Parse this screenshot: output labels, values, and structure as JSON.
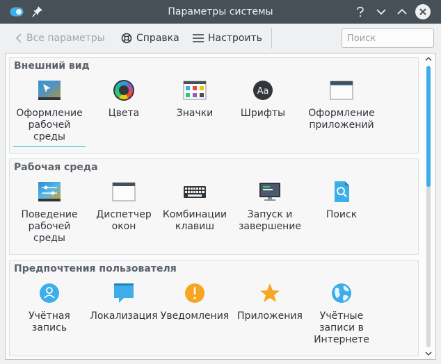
{
  "window": {
    "title": "Параметры системы"
  },
  "toolbar": {
    "back_label": "Все параметры",
    "help_label": "Справка",
    "configure_label": "Настроить",
    "search_placeholder": "Поиск"
  },
  "colors": {
    "accent": "#3daee9",
    "titlebar": "#475057"
  },
  "sections": [
    {
      "title": "Внешний вид",
      "items": [
        {
          "label": "Оформление рабочей среды",
          "icon": "workspace-theme-icon"
        },
        {
          "label": "Цвета",
          "icon": "colors-icon"
        },
        {
          "label": "Значки",
          "icon": "icons-icon"
        },
        {
          "label": "Шрифты",
          "icon": "fonts-icon"
        },
        {
          "label": "Оформление приложений",
          "icon": "app-style-icon"
        }
      ]
    },
    {
      "title": "Рабочая среда",
      "items": [
        {
          "label": "Поведение рабочей среды",
          "icon": "workspace-behavior-icon"
        },
        {
          "label": "Диспетчер окон",
          "icon": "window-manager-icon"
        },
        {
          "label": "Комбинации клавиш",
          "icon": "keyboard-icon"
        },
        {
          "label": "Запуск и завершение",
          "icon": "startup-shutdown-icon"
        },
        {
          "label": "Поиск",
          "icon": "search-icon"
        }
      ]
    },
    {
      "title": "Предпочтения пользователя",
      "items": [
        {
          "label": "Учётная запись",
          "icon": "user-account-icon"
        },
        {
          "label": "Локализация",
          "icon": "locale-icon"
        },
        {
          "label": "Уведомления",
          "icon": "notifications-icon"
        },
        {
          "label": "Приложения",
          "icon": "applications-icon"
        },
        {
          "label": "Учётные записи в Интернете",
          "icon": "online-accounts-icon"
        }
      ]
    }
  ]
}
